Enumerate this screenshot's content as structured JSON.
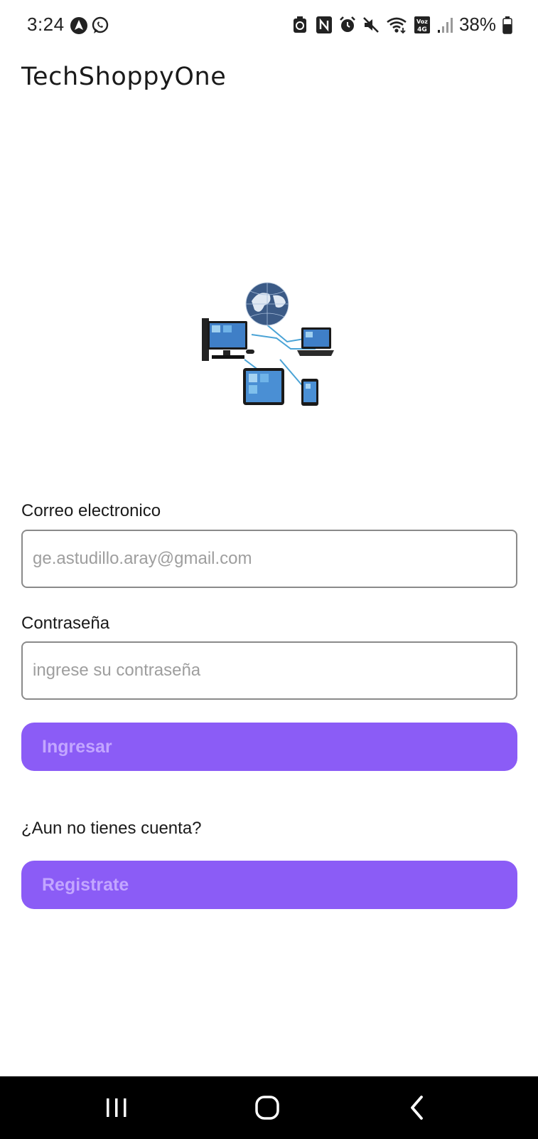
{
  "status_bar": {
    "time": "3:24",
    "battery_percent": "38%",
    "left_icons": [
      "navigation-arrow-icon",
      "whatsapp-icon"
    ],
    "right_icons": [
      "recycle-icon",
      "nfc-icon",
      "alarm-icon",
      "mute-icon",
      "wifi-icon",
      "volte-4g-icon",
      "signal-icon",
      "battery-icon"
    ],
    "volte_text": "Voz 4G"
  },
  "app": {
    "title": "TechShoppyOne"
  },
  "logo": {
    "icon": "globe-network-devices-illustration"
  },
  "form": {
    "email_label": "Correo electronico",
    "email_placeholder": "ge.astudillo.aray@gmail.com",
    "email_value": "",
    "password_label": "Contraseña",
    "password_placeholder": "ingrese su contraseña",
    "password_value": "",
    "login_button": "Ingresar",
    "no_account_text": "¿Aun no tienes cuenta?",
    "register_button": "Registrate"
  },
  "colors": {
    "button_bg": "#8b5cf6",
    "button_text": "#c3a6ff"
  },
  "nav_bar": {
    "buttons": [
      "recents-icon",
      "home-icon",
      "back-icon"
    ]
  }
}
